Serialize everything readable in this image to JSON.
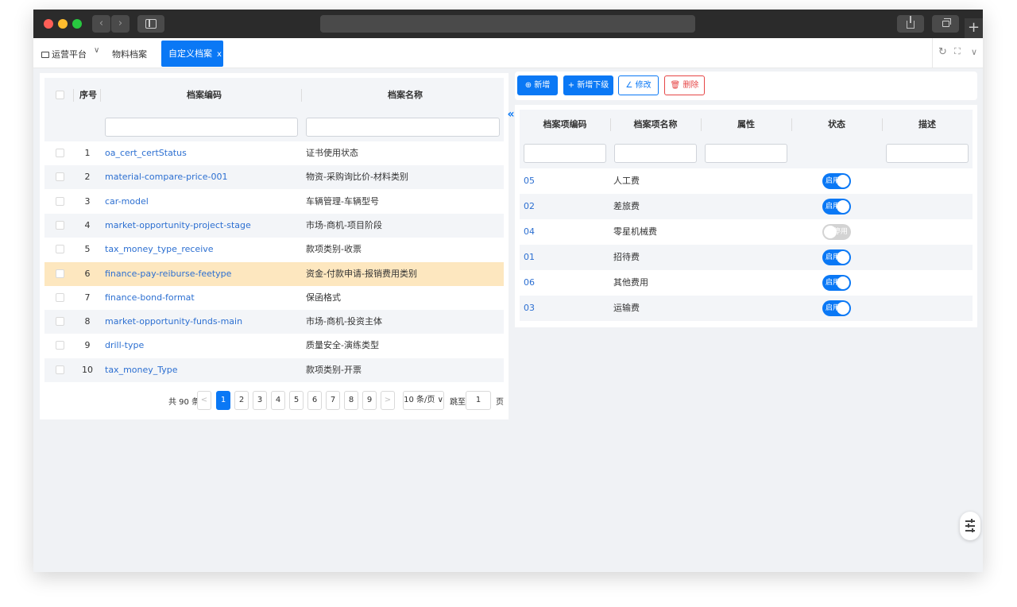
{
  "app": {
    "platform_label": "运营平台",
    "tabs": [
      {
        "label": "物料档案",
        "active": false
      },
      {
        "label": "自定义档案",
        "active": true,
        "close": "x"
      }
    ],
    "accent_color": "#0a78f5"
  },
  "left_table": {
    "columns": [
      "序号",
      "档案编码",
      "档案名称"
    ],
    "rows": [
      {
        "no": "1",
        "code": "oa_cert_certStatus",
        "name": "证书使用状态"
      },
      {
        "no": "2",
        "code": "material-compare-price-001",
        "name": "物资-采购询比价-材料类别"
      },
      {
        "no": "3",
        "code": "car-model",
        "name": "车辆管理-车辆型号"
      },
      {
        "no": "4",
        "code": "market-opportunity-project-stage",
        "name": "市场-商机-项目阶段"
      },
      {
        "no": "5",
        "code": "tax_money_type_receive",
        "name": "款项类别-收票"
      },
      {
        "no": "6",
        "code": "finance-pay-reiburse-feetype",
        "name": "资金-付款申请-报销费用类别",
        "selected": true
      },
      {
        "no": "7",
        "code": "finance-bond-format",
        "name": "保函格式"
      },
      {
        "no": "8",
        "code": "market-opportunity-funds-main",
        "name": "市场-商机-投资主体"
      },
      {
        "no": "9",
        "code": "drill-type",
        "name": "质量安全-演练类型"
      },
      {
        "no": "10",
        "code": "tax_money_Type",
        "name": "款项类别-开票"
      }
    ]
  },
  "pagination": {
    "total": "共 90 条",
    "pages": [
      "1",
      "2",
      "3",
      "4",
      "5",
      "6",
      "7",
      "8",
      "9"
    ],
    "current": "1",
    "prev": "<",
    "next": ">",
    "page_size": "10 条/页",
    "jump_label": "跳至",
    "jump_value": "1",
    "page_unit": "页"
  },
  "toolbar": {
    "add": "新增",
    "add_child": "新增下级",
    "edit": "修改",
    "delete": "删除"
  },
  "right_table": {
    "columns": [
      "档案项编码",
      "档案项名称",
      "属性",
      "状态",
      "描述"
    ],
    "rows": [
      {
        "code": "05",
        "name": "人工费",
        "status": "启用",
        "enabled": true
      },
      {
        "code": "02",
        "name": "差旅费",
        "status": "启用",
        "enabled": true
      },
      {
        "code": "04",
        "name": "零星机械费",
        "status": "停用",
        "enabled": false
      },
      {
        "code": "01",
        "name": "招待费",
        "status": "启用",
        "enabled": true
      },
      {
        "code": "06",
        "name": "其他费用",
        "status": "启用",
        "enabled": true
      },
      {
        "code": "03",
        "name": "运输费",
        "status": "启用",
        "enabled": true
      }
    ]
  }
}
